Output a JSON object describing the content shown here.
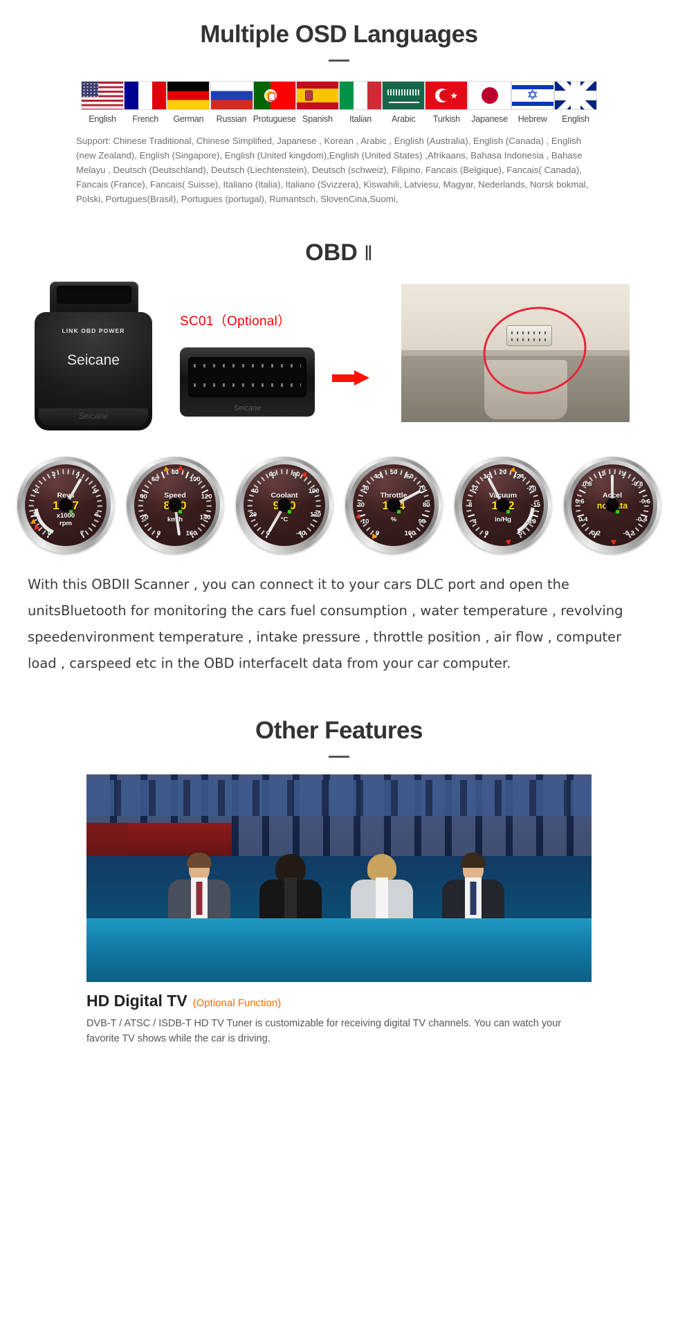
{
  "osd": {
    "title": "Multiple OSD Languages",
    "flags": [
      {
        "label": "English",
        "icon": "flag-us-icon",
        "cls": "f-us"
      },
      {
        "label": "French",
        "icon": "flag-fr-icon",
        "cls": "f-fr"
      },
      {
        "label": "German",
        "icon": "flag-de-icon",
        "cls": "f-de"
      },
      {
        "label": "Russian",
        "icon": "flag-ru-icon",
        "cls": "f-ru"
      },
      {
        "label": "Protuguese",
        "icon": "flag-pt-icon",
        "cls": "f-pt"
      },
      {
        "label": "Spanish",
        "icon": "flag-es-icon",
        "cls": "f-es"
      },
      {
        "label": "Italian",
        "icon": "flag-it-icon",
        "cls": "f-it"
      },
      {
        "label": "Arabic",
        "icon": "flag-sa-icon",
        "cls": "f-sa"
      },
      {
        "label": "Turkish",
        "icon": "flag-tr-icon",
        "cls": "f-tr"
      },
      {
        "label": "Japanese",
        "icon": "flag-jp-icon",
        "cls": "f-jp"
      },
      {
        "label": "Hebrew",
        "icon": "flag-il-icon",
        "cls": "f-il"
      },
      {
        "label": "English",
        "icon": "flag-uk-icon",
        "cls": "f-uk"
      }
    ],
    "support_text": "Support: Chinese Traditional, Chinese Simplified, Japanese , Korean , Arabic , English (Australia), English (Canada) , English (new Zealand), English (Singapore), English (United kingdom),English (United States) ,Afrikaans, Bahasa Indonesia , Bahase Melayu , Deutsch (Deutschland), Deutsch (Liechtenstein), Deutsch (schweiz), Filipino, Fancais (Belgique), Fancais( Canada), Fancais (France), Fancais( Suisse), Italiano (Italia), Italiano (Svizzera), Kiswahili, Latviesu, Magyar, Nederlands, Norsk bokmal, Polski, Portugues(Brasil), Portugues (portugal), Rumantsch, SlovenCina,Suomi,"
  },
  "obd": {
    "title": "OBD",
    "title_suffix": "‖",
    "dongle": {
      "leds": "LINK   OBD   POWER",
      "brand": "Seicane",
      "brand_small": "Seicane"
    },
    "plug": {
      "caption": "SC01（Optional）",
      "brand_small": "Seicane"
    },
    "arrow_icon": "right-arrow-icon",
    "car_photo_alt": "car-dlc-port-photo"
  },
  "gauges": [
    {
      "name": "Revs",
      "value": "1767",
      "unit": "x1000\nrpm",
      "ticks": [
        "0",
        "1",
        "2",
        "3",
        "4",
        "5",
        "6",
        "7"
      ],
      "needle_deg": -150,
      "markers": [
        {
          "type": "red",
          "deg": -128
        },
        {
          "type": "org",
          "deg": -118
        }
      ]
    },
    {
      "name": "Speed",
      "value": "87.0",
      "unit": "km/h",
      "ticks": [
        "0",
        "20",
        "40",
        "60",
        "80",
        "100",
        "120",
        "140",
        "160"
      ],
      "needle_deg": -8,
      "markers": [
        {
          "type": "org",
          "deg": -14
        },
        {
          "type": "red",
          "deg": 8
        }
      ]
    },
    {
      "name": "Coolant",
      "value": "97.0",
      "unit": "°C",
      "ticks": [
        "0",
        "20",
        "40",
        "60",
        "80",
        "100",
        "120",
        "-40"
      ],
      "needle_deg": 30,
      "markers": [
        {
          "type": "red",
          "deg": 34
        }
      ]
    },
    {
      "name": "Throttle",
      "value": "18.4",
      "unit": "%",
      "ticks": [
        "0",
        "10",
        "20",
        "30",
        "40",
        "50",
        "60",
        "70",
        "80",
        "90",
        "100"
      ],
      "needle_deg": -118,
      "markers": [
        {
          "type": "red",
          "deg": -108
        },
        {
          "type": "org",
          "deg": -148
        }
      ]
    },
    {
      "name": "Vacuum",
      "value": "16.2",
      "unit": "in/Hg",
      "ticks": [
        "0",
        "4",
        "8",
        "12",
        "16",
        "20",
        "-24",
        "-20",
        "-15",
        "-10",
        "-5"
      ],
      "needle_deg": 152,
      "markers": [
        {
          "type": "org",
          "deg": 16
        },
        {
          "type": "red",
          "deg": 172
        }
      ]
    },
    {
      "name": "Accel",
      "value": "no data",
      "unit": "",
      "ticks": [
        "0.2",
        "0.4",
        "0.6",
        "0.8",
        "1",
        "-1",
        "-0.8",
        "-0.6",
        "-0.4",
        "-0.2"
      ],
      "needle_deg": 180,
      "markers": [
        {
          "type": "red",
          "deg": 178
        }
      ]
    }
  ],
  "description": "With this OBDII Scanner , you can connect it to your cars DLC port and open the unitsBluetooth for monitoring the cars fuel consumption , water temperature , revolving speedenvironment temperature , intake pressure , throttle position , air flow , computer load , carspeed etc in the OBD interfaceIt data from your car computer.",
  "other_features": {
    "title": "Other Features",
    "tv_image_alt": "news-studio-anchors-photo",
    "hdtv_title": "HD Digital TV",
    "hdtv_optional": "(Optional Function)",
    "hdtv_desc": "DVB-T / ATSC / ISDB-T HD TV Tuner is customizable for receiving digital TV channels. You can watch your favorite TV shows while the car is driving."
  },
  "colors": {
    "accent_red": "#ff0000",
    "accent_orange": "#ff6a00",
    "gauge_value": "#ffe400",
    "heading": "#333333"
  }
}
